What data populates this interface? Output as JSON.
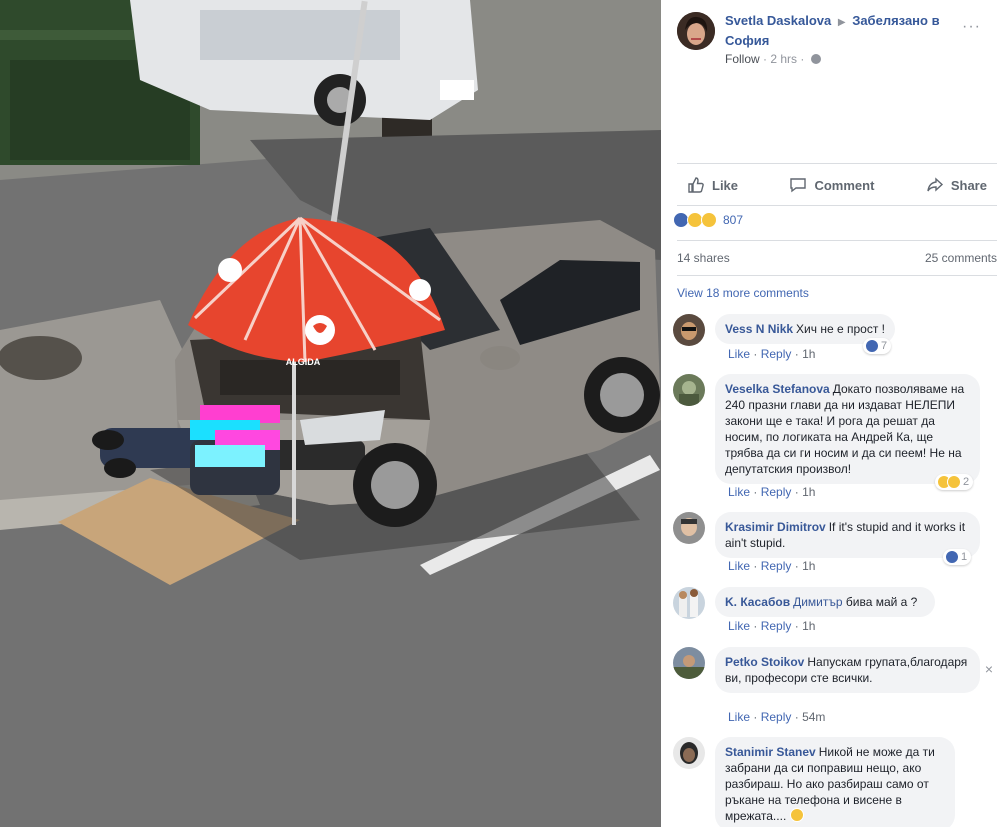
{
  "post": {
    "author": "Svetla Daskalova",
    "group": "Забелязано в София",
    "follow": "Follow",
    "time": "2 hrs",
    "separator": "·"
  },
  "actions": {
    "like": "Like",
    "comment": "Comment",
    "share": "Share"
  },
  "reactions": {
    "count": "807"
  },
  "stats": {
    "shares": "14 shares",
    "comments": "25 comments"
  },
  "view_more": "View 18 more comments",
  "photo": {
    "umbrella_brand": "ALGIDA"
  },
  "comments": [
    {
      "name": "Vess N Nikk",
      "text": "Хич не е прост !",
      "like": "Like",
      "reply": "Reply",
      "time": "1h",
      "reactions": "7"
    },
    {
      "name": "Veselka Stefanova",
      "text": "Докато позволяваме на 240 празни глави да ни издават НЕЛЕПИ закони ще е така! И рога да решат да носим, по логиката на Андрей Ка, ще трябва да си ги носим и да си пеем! Не на депутатския произвол!",
      "like": "Like",
      "reply": "Reply",
      "time": "1h",
      "reactions": "2"
    },
    {
      "name": "Krasimir Dimitrov",
      "text": "If it's stupid and it works it ain't stupid.",
      "like": "Like",
      "reply": "Reply",
      "time": "1h",
      "reactions": "1"
    },
    {
      "name": "K. Касабов",
      "mention": "Димитър",
      "text": "бива май а ?",
      "like": "Like",
      "reply": "Reply",
      "time": "1h"
    },
    {
      "name": "Petko Stoikov",
      "text": "Напускам групата,благодаря ви, професори сте всички.",
      "like": "Like",
      "reply": "Reply",
      "time": "54m"
    },
    {
      "name": "Stanimir Stanev",
      "text": "Никой не може да ти забрани да си поправиш нещо, ако разбираш. Но ако разбираш само от ръкане на телефона и висене в мрежата...."
    }
  ]
}
